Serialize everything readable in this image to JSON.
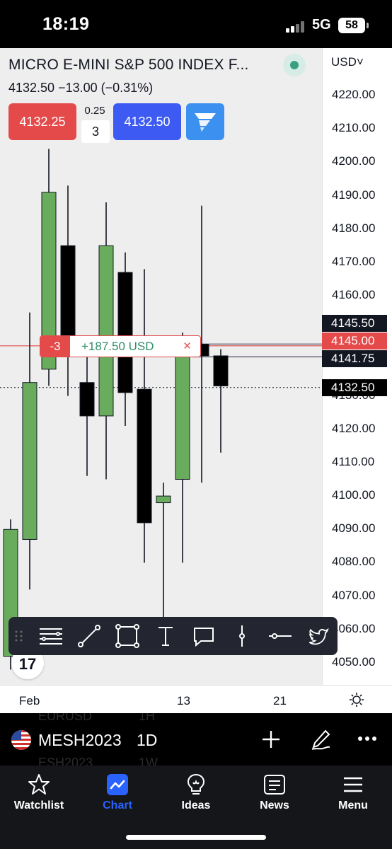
{
  "status_bar": {
    "time": "18:19",
    "network": "5G",
    "battery": "58"
  },
  "header": {
    "symbol_title": "MICRO E-MINI S&P 500 INDEX F...",
    "price_change": "4132.50  −13.00 (−0.31%)",
    "currency": "USD˅"
  },
  "trade": {
    "sell_price": "4132.25",
    "spread": "0.25",
    "quantity": "3",
    "buy_price": "4132.50"
  },
  "price_axis": {
    "labels": [
      "4220.00",
      "4210.00",
      "4200.00",
      "4190.00",
      "4180.00",
      "4170.00",
      "4160.00",
      "4130.00",
      "4120.00",
      "4110.00",
      "4100.00",
      "4090.00",
      "4080.00",
      "4070.00",
      "4060.00",
      "4050.00"
    ],
    "tag_high": "4145.50",
    "tag_entry": "4145.00",
    "tag_low": "4141.75",
    "tag_last": "4132.50"
  },
  "position": {
    "qty": "-3",
    "pnl": "+187.50 USD",
    "close": "×"
  },
  "logo_text": "17",
  "date_axis": {
    "labels": [
      "Feb",
      "13",
      "21"
    ]
  },
  "symbol_bar": {
    "ghost_prev_symbol": "EURUSD",
    "ghost_prev_interval": "1H",
    "symbol": "MESH2023",
    "interval": "1D",
    "ghost_next_symbol": "ESH2023",
    "ghost_next_interval": "1W"
  },
  "tabs": [
    {
      "label": "Watchlist",
      "icon": "star-icon",
      "active": false
    },
    {
      "label": "Chart",
      "icon": "chart-icon",
      "active": true
    },
    {
      "label": "Ideas",
      "icon": "lightbulb-icon",
      "active": false
    },
    {
      "label": "News",
      "icon": "news-icon",
      "active": false
    },
    {
      "label": "Menu",
      "icon": "hamburger-icon",
      "active": false
    }
  ],
  "colors": {
    "up": "#6aac5e",
    "down": "#000000",
    "sell": "#e44a4a",
    "buy": "#3d5bf2",
    "active_tab": "#2962ff"
  },
  "chart_data": {
    "type": "candlestick",
    "y_range": [
      4045,
      4227
    ],
    "candles": [
      {
        "open": 4052,
        "high": 4093,
        "low": 4048,
        "close": 4090,
        "dir": "up"
      },
      {
        "open": 4087,
        "high": 4155,
        "low": 4072,
        "close": 4134,
        "dir": "up"
      },
      {
        "open": 4138,
        "high": 4204,
        "low": 4133,
        "close": 4191,
        "dir": "up"
      },
      {
        "open": 4175,
        "high": 4193,
        "low": 4130,
        "close": 4148,
        "dir": "down"
      },
      {
        "open": 4134,
        "high": 4147,
        "low": 4106,
        "close": 4124,
        "dir": "down"
      },
      {
        "open": 4124,
        "high": 4188,
        "low": 4105,
        "close": 4175,
        "dir": "up"
      },
      {
        "open": 4167,
        "high": 4173,
        "low": 4121,
        "close": 4131,
        "dir": "down"
      },
      {
        "open": 4132,
        "high": 4168,
        "low": 4080,
        "close": 4092,
        "dir": "down"
      },
      {
        "open": 4098,
        "high": 4104,
        "low": 4057,
        "close": 4100,
        "dir": "up"
      },
      {
        "open": 4105,
        "high": 4149,
        "low": 4080,
        "close": 4142,
        "dir": "up"
      },
      {
        "open": 4145.5,
        "high": 4187,
        "low": 4104,
        "close": 4142,
        "dir": "down"
      },
      {
        "open": 4142,
        "high": 4144,
        "low": 4113,
        "close": 4133,
        "dir": "down"
      }
    ],
    "lines": {
      "high": 4145.5,
      "entry": 4145.0,
      "low": 4141.75,
      "last": 4132.5
    }
  }
}
